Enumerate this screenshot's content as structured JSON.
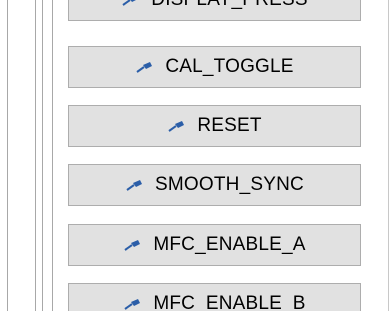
{
  "buttons": [
    {
      "id": "display-press",
      "label": "DISPLAY_PRESS"
    },
    {
      "id": "cal-toggle",
      "label": "CAL_TOGGLE"
    },
    {
      "id": "reset",
      "label": "RESET"
    },
    {
      "id": "smooth-sync",
      "label": "SMOOTH_SYNC"
    },
    {
      "id": "mfc-enable-a",
      "label": "MFC_ENABLE_A"
    },
    {
      "id": "mfc-enable-b",
      "label": "MFC_ENABLE_B"
    }
  ],
  "colors": {
    "button_face": "#e1e1e1",
    "button_border": "#adadad",
    "icon": "#2b5ea8"
  },
  "icon_name": "pin-icon"
}
